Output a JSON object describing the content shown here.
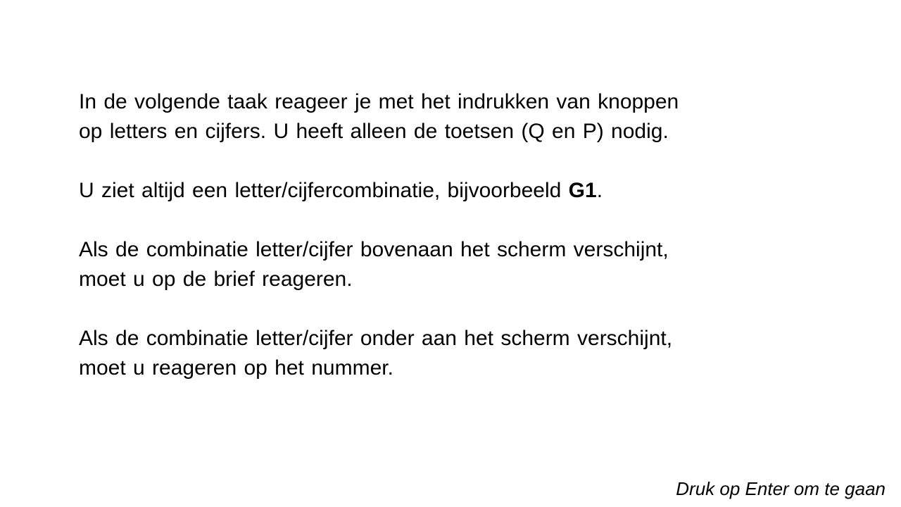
{
  "instructions": {
    "p1": {
      "line1": "In de volgende taak reageer je met het indrukken van knoppen",
      "line2": "op letters en cijfers. U heeft alleen de toetsen (Q en P) nodig."
    },
    "p2": {
      "prefix": "U ziet altijd een letter/cijfercombinatie, bijvoorbeeld ",
      "example": "G1",
      "suffix": "."
    },
    "p3": {
      "line1": "Als de combinatie letter/cijfer bovenaan het scherm verschijnt,",
      "line2": "moet u op de brief reageren."
    },
    "p4": {
      "line1": "Als de combinatie letter/cijfer onder aan het scherm verschijnt,",
      "line2": "moet u reageren op het nummer."
    }
  },
  "footer": {
    "continue_hint": "Druk op Enter om te gaan"
  }
}
